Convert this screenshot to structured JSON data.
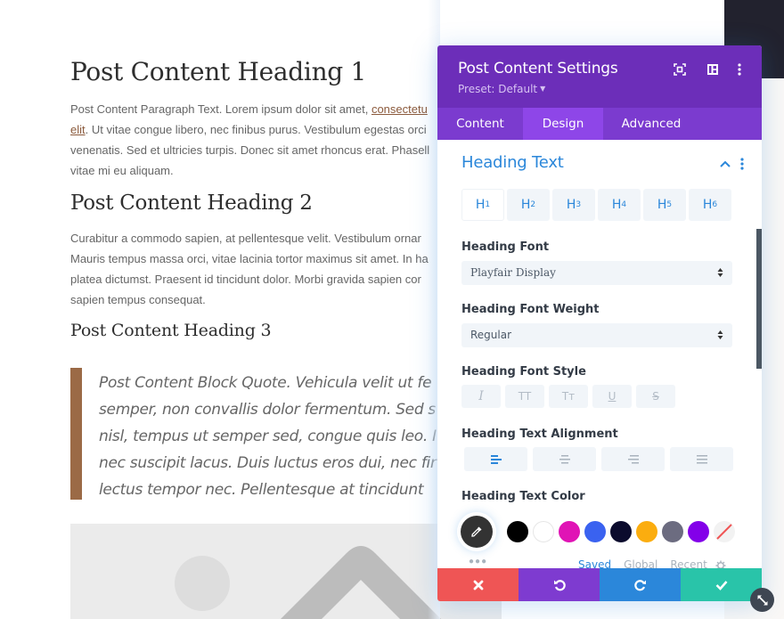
{
  "post": {
    "heading1": "Post Content Heading 1",
    "paragraph1": {
      "line1_before_link": "Post Content Paragraph Text. Lorem ipsum dolor sit amet, ",
      "link_part1": "consectetu",
      "link_part2": "elit",
      "line2_after_link": ". Ut vitae congue libero, nec finibus purus. Vestibulum egestas orci",
      "line3": "venenatis. Sed et ultricies turpis. Donec sit amet rhoncus erat. Phasell",
      "line4": "vitae mi eu aliquam."
    },
    "heading2": "Post Content Heading 2",
    "paragraph2": {
      "line1": "Curabitur a commodo sapien, at pellentesque velit. Vestibulum ornar",
      "line2": "Mauris tempus massa orci, vitae lacinia tortor maximus sit amet. In ha",
      "line3": "platea dictumst. Praesent id tincidunt dolor. Morbi gravida sapien cor",
      "line4": "sapien tempus consequat."
    },
    "heading3": "Post Content Heading 3",
    "blockquote": {
      "line1": "Post Content Block Quote. Vehicula velit ut fe",
      "line2": "semper, non convallis dolor fermentum. Sed s",
      "line3": "nisl, tempus ut semper sed, congue quis leo. I",
      "line4": "nec suscipit lacus. Duis luctus eros dui, nec fir",
      "line5": "lectus tempor nec. Pellentesque at tincidunt"
    },
    "image_placeholder": "image-placeholder-icon"
  },
  "modal": {
    "title": "Post Content Settings",
    "preset": "Preset: Default",
    "header_icons": [
      "focus-icon",
      "split-view-icon",
      "more-vertical-icon"
    ],
    "tabs": [
      {
        "label": "Content",
        "active": false
      },
      {
        "label": "Design",
        "active": true
      },
      {
        "label": "Advanced",
        "active": false
      }
    ],
    "section": {
      "title": "Heading Text",
      "heading_levels": [
        {
          "label": "H",
          "sub": "1",
          "active": true
        },
        {
          "label": "H",
          "sub": "2",
          "active": false
        },
        {
          "label": "H",
          "sub": "3",
          "active": false
        },
        {
          "label": "H",
          "sub": "4",
          "active": false
        },
        {
          "label": "H",
          "sub": "5",
          "active": false
        },
        {
          "label": "H",
          "sub": "6",
          "active": false
        }
      ],
      "font_label": "Heading Font",
      "font_value": "Playfair Display",
      "weight_label": "Heading Font Weight",
      "weight_value": "Regular",
      "style_label": "Heading Font Style",
      "style_buttons": [
        "I",
        "TT",
        "Tт",
        "U",
        "S"
      ],
      "alignment_label": "Heading Text Alignment",
      "alignment_options": [
        "left",
        "center",
        "right",
        "justify"
      ],
      "alignment_active": "left",
      "color_label": "Heading Text Color",
      "color_swatches": [
        "#000000",
        "#ffffff",
        "#e014b5",
        "#3a62f0",
        "#0b0b2d",
        "#fbad0f",
        "#6c6c80",
        "#8300e9",
        "none"
      ],
      "color_tabs": [
        {
          "label": "Saved",
          "active": true
        },
        {
          "label": "Global",
          "active": false
        },
        {
          "label": "Recent",
          "active": false
        }
      ]
    },
    "footer": {
      "cancel": "cancel-icon",
      "undo": "undo-icon",
      "redo": "redo-icon",
      "save": "check-icon"
    }
  },
  "colors": {
    "modal_header": "#6c2eb9",
    "modal_tabs": "#7b3bcf",
    "active_tab": "#8e46e8",
    "accent_blue": "#2b87da",
    "cancel_red": "#ef5555",
    "undo_purple": "#7e3bd0",
    "save_green": "#29c4a9",
    "quote_bar": "#9b6a46"
  }
}
